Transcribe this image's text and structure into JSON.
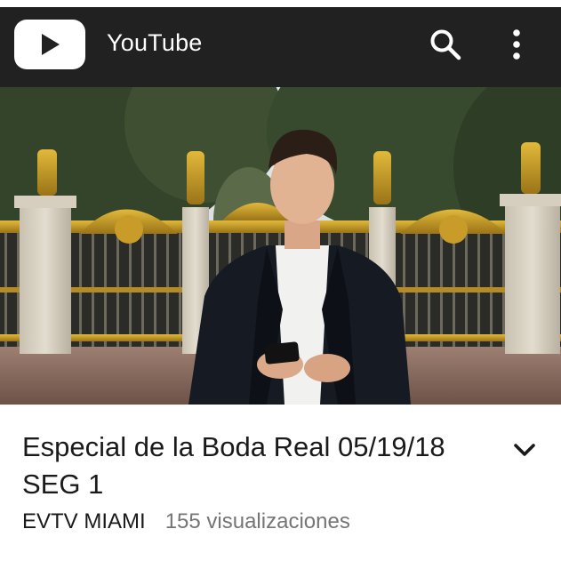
{
  "app": {
    "title": "YouTube"
  },
  "icons": {
    "logo": "youtube-play-logo",
    "search": "search-icon",
    "more": "more-vert-icon",
    "expand": "chevron-down-icon"
  },
  "colors": {
    "appbar": "#212121",
    "logo_bg": "#ffffff",
    "title_text": "#1a1a1a",
    "secondary_text": "#757575"
  },
  "video": {
    "title": "Especial de la Boda Real 05/19/18 SEG 1",
    "channel": "EVTV MIAMI",
    "views": "155 visualizaciones"
  }
}
